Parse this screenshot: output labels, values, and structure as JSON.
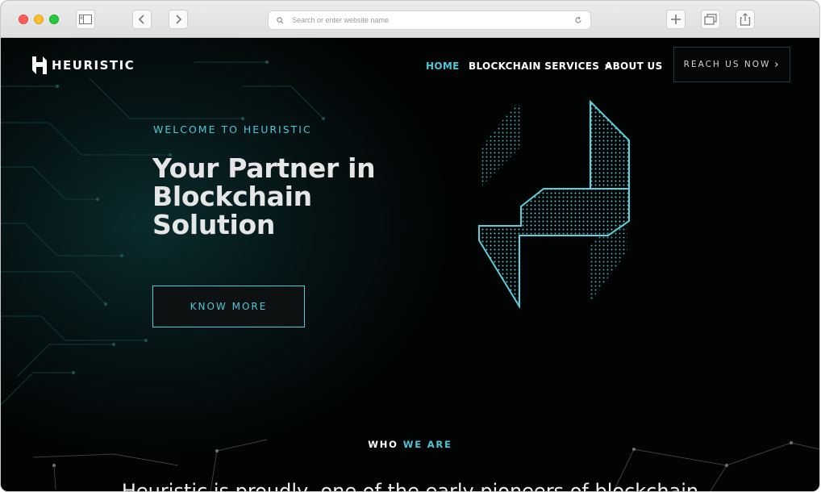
{
  "browser": {
    "url_placeholder": "Search or enter website name"
  },
  "brand": {
    "name": "HEURISTIC",
    "accent": "#4cc8d8"
  },
  "nav": {
    "home": "HOME",
    "services": "BLOCKCHAIN SERVICES",
    "about": "ABOUT US",
    "cta": "REACH US NOW"
  },
  "hero": {
    "eyebrow": "WELCOME TO HEURISTIC",
    "headline_lines": [
      "Your Partner in",
      "Blockchain",
      "Solution"
    ],
    "button": "KNOW MORE"
  },
  "who": {
    "part1": "WHO",
    "part2": "WE ARE"
  },
  "intro_text": "Heuristic is proudly, one of the early pioneers of blockchain"
}
